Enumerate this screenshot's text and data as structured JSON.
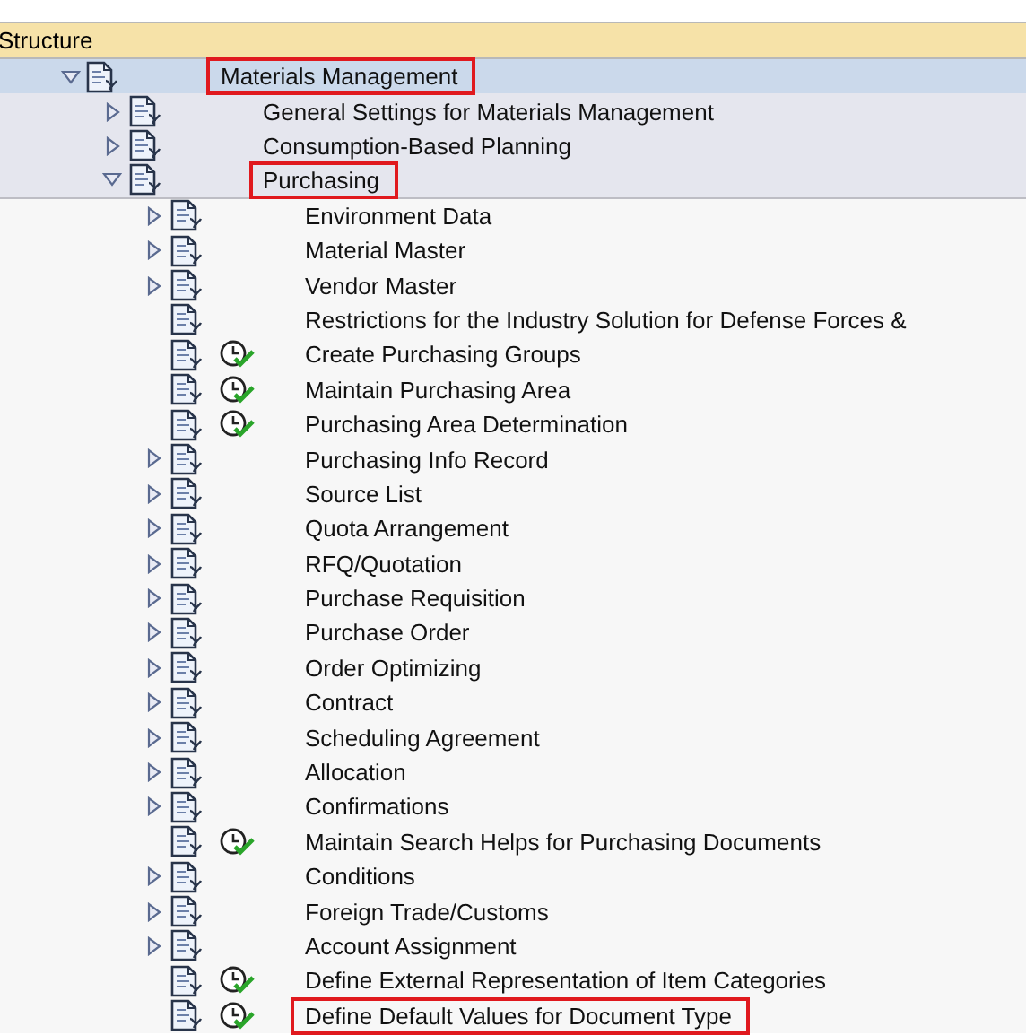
{
  "header": {
    "title": "Structure"
  },
  "tree": [
    {
      "label": "Materials Management",
      "expanded": true,
      "selected": true,
      "highlighted": true,
      "activity": false,
      "children": [
        {
          "label": "General Settings for Materials Management",
          "expanded": false,
          "selected": false,
          "highlighted": false,
          "activity": false
        },
        {
          "label": "Consumption-Based Planning",
          "expanded": false,
          "selected": false,
          "highlighted": false,
          "activity": false
        },
        {
          "label": "Purchasing",
          "expanded": true,
          "selected": false,
          "highlighted": true,
          "activity": false,
          "children": [
            {
              "label": "Environment Data",
              "expanded": false,
              "selected": false,
              "highlighted": false,
              "activity": false
            },
            {
              "label": "Material Master",
              "expanded": false,
              "selected": false,
              "highlighted": false,
              "activity": false
            },
            {
              "label": "Vendor Master",
              "expanded": false,
              "selected": false,
              "highlighted": false,
              "activity": false
            },
            {
              "label": "Restrictions for the Industry Solution for Defense Forces &",
              "selected": false,
              "highlighted": false,
              "activity": false
            },
            {
              "label": "Create Purchasing Groups",
              "selected": false,
              "highlighted": false,
              "activity": true
            },
            {
              "label": "Maintain Purchasing Area",
              "selected": false,
              "highlighted": false,
              "activity": true
            },
            {
              "label": "Purchasing Area Determination",
              "selected": false,
              "highlighted": false,
              "activity": true
            },
            {
              "label": "Purchasing Info Record",
              "expanded": false,
              "selected": false,
              "highlighted": false,
              "activity": false
            },
            {
              "label": "Source List",
              "expanded": false,
              "selected": false,
              "highlighted": false,
              "activity": false
            },
            {
              "label": "Quota Arrangement",
              "expanded": false,
              "selected": false,
              "highlighted": false,
              "activity": false
            },
            {
              "label": "RFQ/Quotation",
              "expanded": false,
              "selected": false,
              "highlighted": false,
              "activity": false
            },
            {
              "label": "Purchase Requisition",
              "expanded": false,
              "selected": false,
              "highlighted": false,
              "activity": false
            },
            {
              "label": "Purchase Order",
              "expanded": false,
              "selected": false,
              "highlighted": false,
              "activity": false
            },
            {
              "label": "Order Optimizing",
              "expanded": false,
              "selected": false,
              "highlighted": false,
              "activity": false
            },
            {
              "label": "Contract",
              "expanded": false,
              "selected": false,
              "highlighted": false,
              "activity": false
            },
            {
              "label": "Scheduling Agreement",
              "expanded": false,
              "selected": false,
              "highlighted": false,
              "activity": false
            },
            {
              "label": "Allocation",
              "expanded": false,
              "selected": false,
              "highlighted": false,
              "activity": false
            },
            {
              "label": "Confirmations",
              "expanded": false,
              "selected": false,
              "highlighted": false,
              "activity": false
            },
            {
              "label": "Maintain Search Helps for Purchasing Documents",
              "selected": false,
              "highlighted": false,
              "activity": true
            },
            {
              "label": "Conditions",
              "expanded": false,
              "selected": false,
              "highlighted": false,
              "activity": false
            },
            {
              "label": "Foreign Trade/Customs",
              "expanded": false,
              "selected": false,
              "highlighted": false,
              "activity": false
            },
            {
              "label": "Account Assignment",
              "expanded": false,
              "selected": false,
              "highlighted": false,
              "activity": false
            },
            {
              "label": "Define External Representation of Item Categories",
              "selected": false,
              "highlighted": false,
              "activity": true
            },
            {
              "label": "Define Default Values for Document Type",
              "selected": false,
              "highlighted": true,
              "activity": true
            }
          ]
        }
      ]
    }
  ]
}
